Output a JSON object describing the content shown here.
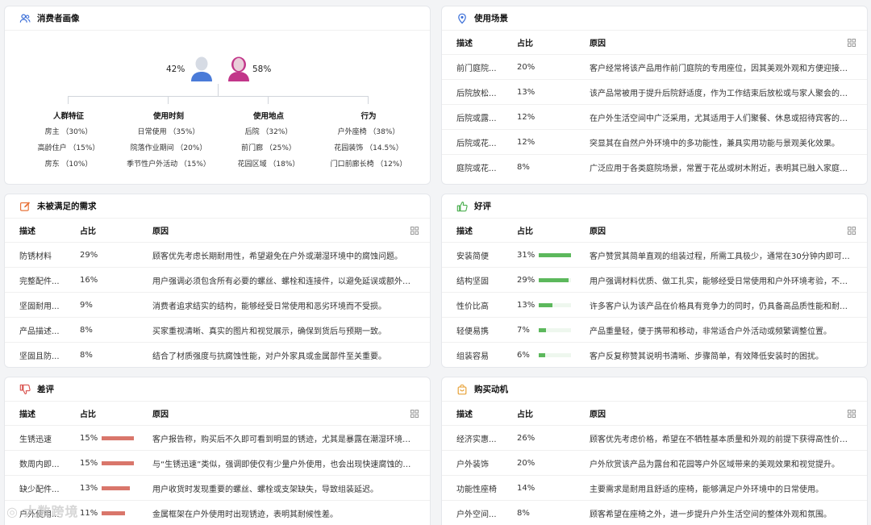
{
  "persona": {
    "title": "消费者画像",
    "male_pct": "42%",
    "female_pct": "58%",
    "columns": [
      {
        "head": "人群特征",
        "items": [
          "房主 （30%）",
          "高龄住户 （15%）",
          "房东 （10%）"
        ]
      },
      {
        "head": "使用时刻",
        "items": [
          "日常使用 （35%）",
          "院落作业期间 （20%）",
          "季节性户外活动 （15%）"
        ]
      },
      {
        "head": "使用地点",
        "items": [
          "后院 （32%）",
          "前门廊 （25%）",
          "花园区域 （18%）"
        ]
      },
      {
        "head": "行为",
        "items": [
          "户外座椅 （38%）",
          "花园装饰 （14.5%）",
          "门口前廊长椅 （12%）"
        ]
      }
    ]
  },
  "scenes": {
    "title": "使用场景",
    "headers": {
      "desc": "描述",
      "pct": "占比",
      "reason": "原因"
    },
    "rows": [
      {
        "desc": "前门庭院...",
        "pct": "20%",
        "reason": "客户经常将该产品用作前门庭院的专用座位，因其美观外观和方便迎接客人..."
      },
      {
        "desc": "后院放松...",
        "pct": "13%",
        "reason": "该产品常被用于提升后院舒适度，作为工作结束后放松或与家人聚会的宁静..."
      },
      {
        "desc": "后院或露...",
        "pct": "12%",
        "reason": "在户外生活空间中广泛采用，尤其适用于人们聚餐、休息或招待宾客的区域。"
      },
      {
        "desc": "后院或花...",
        "pct": "12%",
        "reason": "突显其在自然户外环境中的多功能性，兼具实用功能与景观美化效果。"
      },
      {
        "desc": "庭院或花...",
        "pct": "8%",
        "reason": "广泛应用于各类庭院场景，常置于花丛或树木附近，表明其已融入家庭园艺..."
      }
    ]
  },
  "unmet": {
    "title": "未被满足的需求",
    "headers": {
      "desc": "描述",
      "pct": "占比",
      "reason": "原因"
    },
    "rows": [
      {
        "desc": "防锈材料",
        "pct": "29%",
        "reason": "顾客优先考虑长期耐用性，希望避免在户外或潮湿环境中的腐蚀问题。"
      },
      {
        "desc": "完整配件...",
        "pct": "16%",
        "reason": "用户强调必须包含所有必要的螺丝、螺栓和连接件，以避免延误或额外购买。"
      },
      {
        "desc": "坚固耐用...",
        "pct": "9%",
        "reason": "消费者追求结实的结构，能够经受日常使用和恶劣环境而不受损。"
      },
      {
        "desc": "产品描述...",
        "pct": "8%",
        "reason": "买家重视清晰、真实的图片和视觉展示，确保到货后与预期一致。"
      },
      {
        "desc": "坚固且防...",
        "pct": "8%",
        "reason": "结合了材质强度与抗腐蚀性能，对户外家具或金属部件至关重要。"
      }
    ]
  },
  "positive": {
    "title": "好评",
    "headers": {
      "desc": "描述",
      "pct": "占比",
      "reason": "原因"
    },
    "bar_color": "#5cb85c",
    "rows": [
      {
        "desc": "安装简便",
        "pct": "31%",
        "value": 31,
        "reason": "客户赞赏其简单直观的组装过程，所需工具极少，通常在30分钟内即可完成..."
      },
      {
        "desc": "结构坚固",
        "pct": "29%",
        "value": 29,
        "reason": "用户强调材料优质、做工扎实，能够经受日常使用和户外环境考验，不会弯..."
      },
      {
        "desc": "性价比高",
        "pct": "13%",
        "value": 13,
        "reason": "许多客户认为该产品在价格具有竞争力的同时，仍具备高品质性能和耐用性。"
      },
      {
        "desc": "轻便易携",
        "pct": "7%",
        "value": 7,
        "reason": "产品重量轻，便于携带和移动，非常适合户外活动或频繁调整位置。"
      },
      {
        "desc": "组装容易",
        "pct": "6%",
        "value": 6,
        "reason": "客户反复称赞其说明书清晰、步骤简单，有效降低安装时的困扰。"
      }
    ]
  },
  "negative": {
    "title": "差评",
    "headers": {
      "desc": "描述",
      "pct": "占比",
      "reason": "原因"
    },
    "bar_color": "#d9766b",
    "rows": [
      {
        "desc": "生锈迅速",
        "pct": "15%",
        "value": 15,
        "reason": "客户报告称，购买后不久即可看到明显的锈迹，尤其是暴露在潮湿环境中的..."
      },
      {
        "desc": "数周内即...",
        "pct": "15%",
        "value": 15,
        "reason": "与“生锈迅速”类似，强调即使仅有少量户外使用，也会出现快速腐蚀的情况。"
      },
      {
        "desc": "缺少配件...",
        "pct": "13%",
        "value": 13,
        "reason": "用户收货时发现重要的螺丝、螺栓或支架缺失，导致组装延迟。"
      },
      {
        "desc": "户外使用...",
        "pct": "11%",
        "value": 11,
        "reason": "金属框架在户外使用时出现锈迹，表明其耐候性差。"
      }
    ]
  },
  "motivation": {
    "title": "购买动机",
    "headers": {
      "desc": "描述",
      "pct": "占比",
      "reason": "原因"
    },
    "rows": [
      {
        "desc": "经济实惠...",
        "pct": "26%",
        "reason": "顾客优先考虑价格，希望在不牺牲基本质量和外观的前提下获得高性价比。"
      },
      {
        "desc": "户外装饰",
        "pct": "20%",
        "reason": "户外欣赏该产品为露台和花园等户外区域带来的美观效果和视觉提升。"
      },
      {
        "desc": "功能性座椅",
        "pct": "14%",
        "reason": "主要需求是耐用且舒适的座椅，能够满足户外环境中的日常使用。"
      },
      {
        "desc": "户外空间...",
        "pct": "8%",
        "reason": "顾客希望在座椅之外，进一步提升户外生活空间的整体外观和氛围。"
      }
    ]
  },
  "watermark": "大数跨境",
  "colors": {
    "male": "#4a7bd8",
    "female": "#c2368a",
    "accent_blue": "#3b6fd8"
  }
}
